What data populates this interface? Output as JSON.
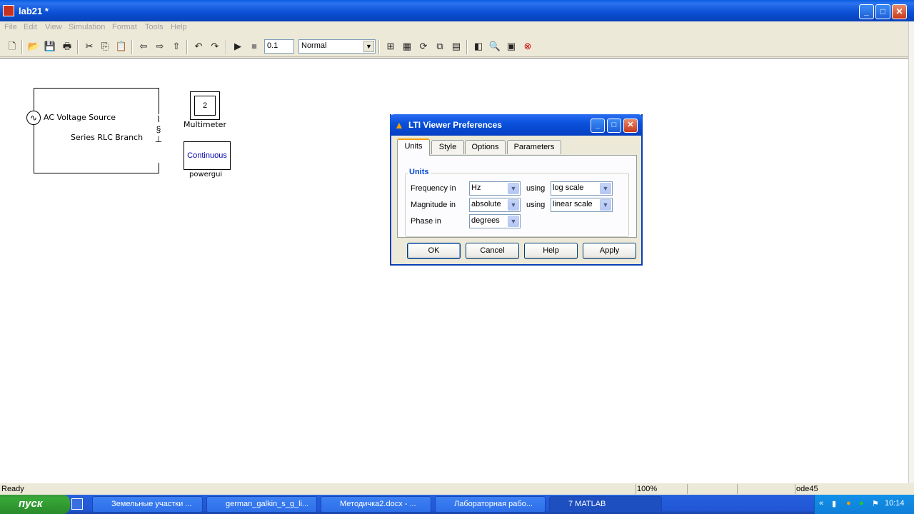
{
  "window": {
    "title": "lab21 *"
  },
  "menu": [
    "File",
    "Edit",
    "View",
    "Simulation",
    "Format",
    "Tools",
    "Help"
  ],
  "toolbar": {
    "stop_time": "0.1",
    "sim_mode": "Normal"
  },
  "model": {
    "ac_source_label": "AC Voltage Source",
    "rlc_label": "Series RLC Branch",
    "multimeter_value": "2",
    "multimeter_label": "Multimeter",
    "powergui_text": "Continuous",
    "powergui_label": "powergui"
  },
  "dialog": {
    "title": "LTI Viewer Preferences",
    "tabs": [
      "Units",
      "Style",
      "Options",
      "Parameters"
    ],
    "group_label": "Units",
    "frequency_label": "Frequency in",
    "frequency_value": "Hz",
    "magnitude_label": "Magnitude in",
    "magnitude_value": "absolute",
    "phase_label": "Phase in",
    "phase_value": "degrees",
    "using1": "using",
    "using2": "using",
    "freq_scale": "log scale",
    "mag_scale": "linear scale",
    "buttons": [
      "OK",
      "Cancel",
      "Help",
      "Apply"
    ]
  },
  "status": {
    "text": "Ready",
    "zoom": "100%",
    "solver": "ode45"
  },
  "taskbar": {
    "start": "пуск",
    "items": [
      "Земельные участки ...",
      "german_galkin_s_g_li...",
      "Методичка2.docx - ...",
      "Лабораторная рабо...",
      "7 MATLAB"
    ],
    "clock": "10:14"
  }
}
